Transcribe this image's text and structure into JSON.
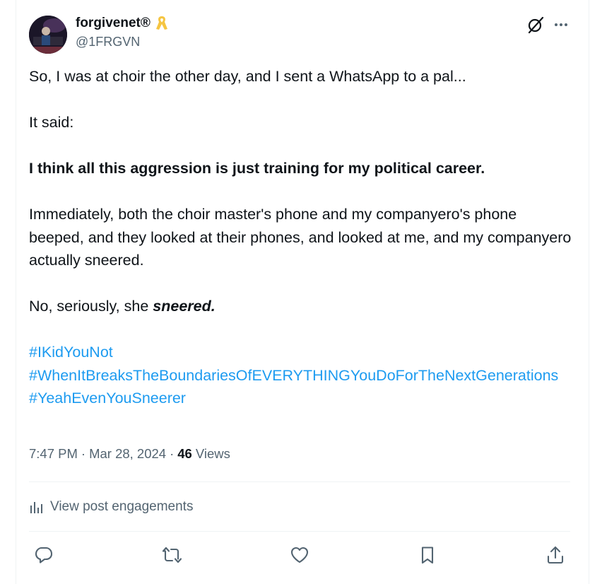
{
  "author": {
    "name": "forgivenet®",
    "handle": "@1FRGVN",
    "badge_icon": "yellow-ribbon-icon"
  },
  "post": {
    "line1": "So, I was at choir the other day, and I sent a WhatsApp to a pal...",
    "line2": "It said:",
    "line3": "I think all this aggression is just training for my political career.",
    "line4": "Immediately, both the choir master's phone and my companyero's phone beeped, and they looked at their phones, and looked at me, and my companyero actually sneered.",
    "line5_prefix": "No, seriously, she ",
    "line5_emph": "sneered.",
    "hashtags": [
      "#IKidYouNot",
      "#WhenItBreaksTheBoundariesOfEVERYTHINGYouDoForTheNextGenerations",
      "#YeahEvenYouSneerer"
    ]
  },
  "meta": {
    "time": "7:47 PM",
    "sep1": "·",
    "date": "Mar 28, 2024",
    "sep2": "·",
    "views_count": "46",
    "views_label": "Views"
  },
  "engagements": {
    "label": "View post engagements",
    "icon": "analytics-icon"
  },
  "actions": [
    "reply-icon",
    "repost-icon",
    "like-icon",
    "bookmark-icon",
    "share-icon"
  ],
  "colors": {
    "accent": "#1d9bf0",
    "text": "#0f1419",
    "muted": "#536471",
    "divider": "#eff3f4",
    "ribbon": "#f5c542"
  }
}
